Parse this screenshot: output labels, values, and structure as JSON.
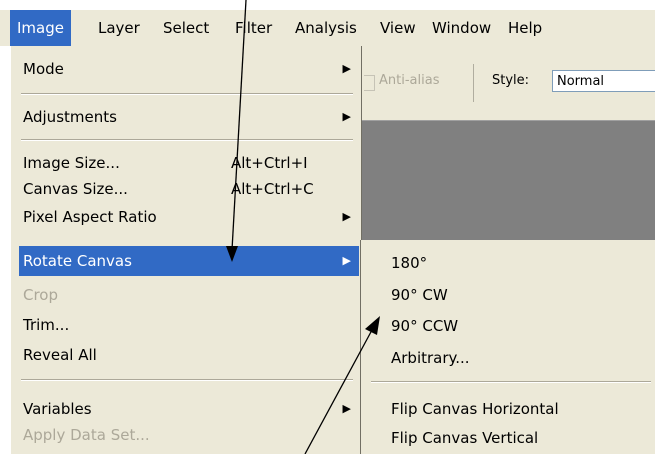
{
  "menubar": {
    "items": [
      {
        "label": "Image",
        "active": true
      },
      {
        "label": "Layer"
      },
      {
        "label": "Select"
      },
      {
        "label": "Filter"
      },
      {
        "label": "Analysis"
      },
      {
        "label": "View"
      },
      {
        "label": "Window"
      },
      {
        "label": "Help"
      }
    ]
  },
  "options_bar": {
    "antialias_label": "Anti-alias",
    "style_label": "Style:",
    "style_value": "Normal"
  },
  "image_menu": {
    "items": [
      {
        "label": "Mode",
        "submenu": true
      },
      {
        "label": "Adjustments",
        "submenu": true
      },
      {
        "label": "Image Size...",
        "shortcut": "Alt+Ctrl+I"
      },
      {
        "label": "Canvas Size...",
        "shortcut": "Alt+Ctrl+C"
      },
      {
        "label": "Pixel Aspect Ratio",
        "submenu": true
      },
      {
        "label": "Rotate Canvas",
        "submenu": true,
        "active": true
      },
      {
        "label": "Crop",
        "disabled": true
      },
      {
        "label": "Trim..."
      },
      {
        "label": "Reveal All"
      },
      {
        "label": "Variables",
        "submenu": true
      },
      {
        "label": "Apply Data Set...",
        "disabled": true
      }
    ]
  },
  "rotate_submenu": {
    "items": [
      {
        "label": "180°"
      },
      {
        "label": "90° CW"
      },
      {
        "label": "90° CCW"
      },
      {
        "label": "Arbitrary..."
      },
      {
        "label": "Flip Canvas Horizontal"
      },
      {
        "label": "Flip Canvas Vertical"
      }
    ]
  },
  "colors": {
    "highlight": "#316ac5",
    "menu_bg": "#ece9d8",
    "disabled_text": "#aca899",
    "canvas_gray": "#808080"
  }
}
